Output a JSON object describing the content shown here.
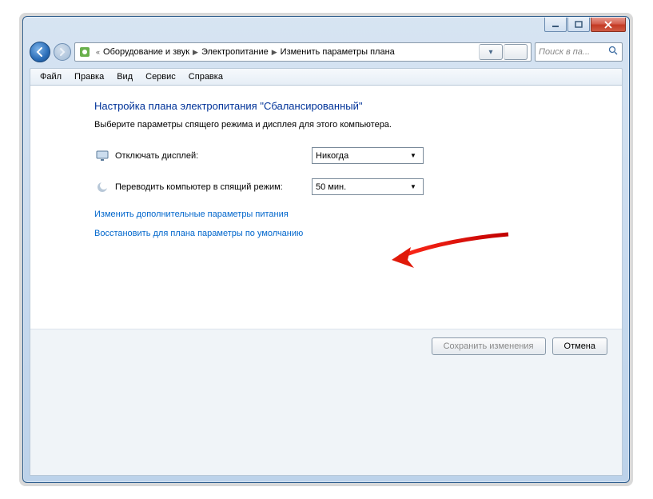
{
  "breadcrumb": {
    "prefix_chevrons": "«",
    "items": [
      "Оборудование и звук",
      "Электропитание",
      "Изменить параметры плана"
    ]
  },
  "search": {
    "placeholder": "Поиск в па..."
  },
  "menu": {
    "file": "Файл",
    "edit": "Правка",
    "view": "Вид",
    "tools": "Сервис",
    "help": "Справка"
  },
  "page": {
    "heading": "Настройка плана электропитания \"Сбалансированный\"",
    "description": "Выберите параметры спящего режима и дисплея для этого компьютера."
  },
  "settings": {
    "display_off": {
      "label": "Отключать дисплей:",
      "value": "Никогда"
    },
    "sleep": {
      "label": "Переводить компьютер в спящий режим:",
      "value": "50 мин."
    }
  },
  "links": {
    "advanced": "Изменить дополнительные параметры питания",
    "restore_defaults": "Восстановить для плана параметры по умолчанию"
  },
  "buttons": {
    "save": "Сохранить изменения",
    "cancel": "Отмена"
  }
}
